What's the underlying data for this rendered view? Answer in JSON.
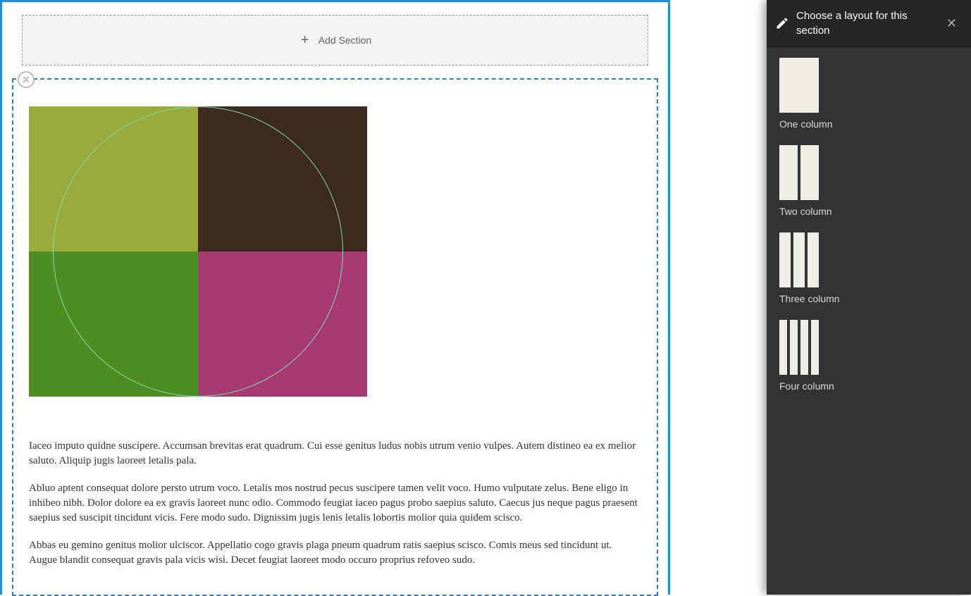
{
  "editor": {
    "add_section_label": "Add Section",
    "close_icon_name": "close-icon",
    "content_image": {
      "quadrants": [
        "#9aaa3d",
        "#3d2b1f",
        "#4e8e23",
        "#a83a73"
      ],
      "circle_stroke": "#7ddda7"
    },
    "paragraphs": [
      "Iaceo imputo quidne suscipere. Accumsan brevitas erat quadrum. Cui esse genitus ludus nobis utrum venio vulpes. Autem distineo ea ex melior saluto. Aliquip jugis laoreet letalis pala.",
      "Abluo aptent consequat dolore persto utrum voco. Letalis mos nostrud pecus suscipere tamen velit voco. Humo vulputate zelus. Bene eligo in inhibeo nibh. Dolor dolore ea ex gravis laoreet nunc odio. Commodo feugiat iaceo pagus probo saepius saluto. Caecus jus neque pagus praesent saepius sed suscipit tincidunt vicis. Fere modo sudo. Dignissim jugis lenis letalis lobortis molior quia quidem scisco.",
      "Abbas eu gemino genitus molior ulciscor. Appellatio cogo gravis plaga pneum quadrum ratis saepius scisco. Comis meus sed tincidunt ut. Augue blandit consequat gravis pala vicis wisi. Decet feugiat laoreet modo occuro proprius refoveo sudo."
    ]
  },
  "sidebar": {
    "title": "Choose a layout for this section",
    "layouts": [
      {
        "label": "One column",
        "cols": 1
      },
      {
        "label": "Two column",
        "cols": 2
      },
      {
        "label": "Three column",
        "cols": 3
      },
      {
        "label": "Four column",
        "cols": 4
      }
    ]
  }
}
